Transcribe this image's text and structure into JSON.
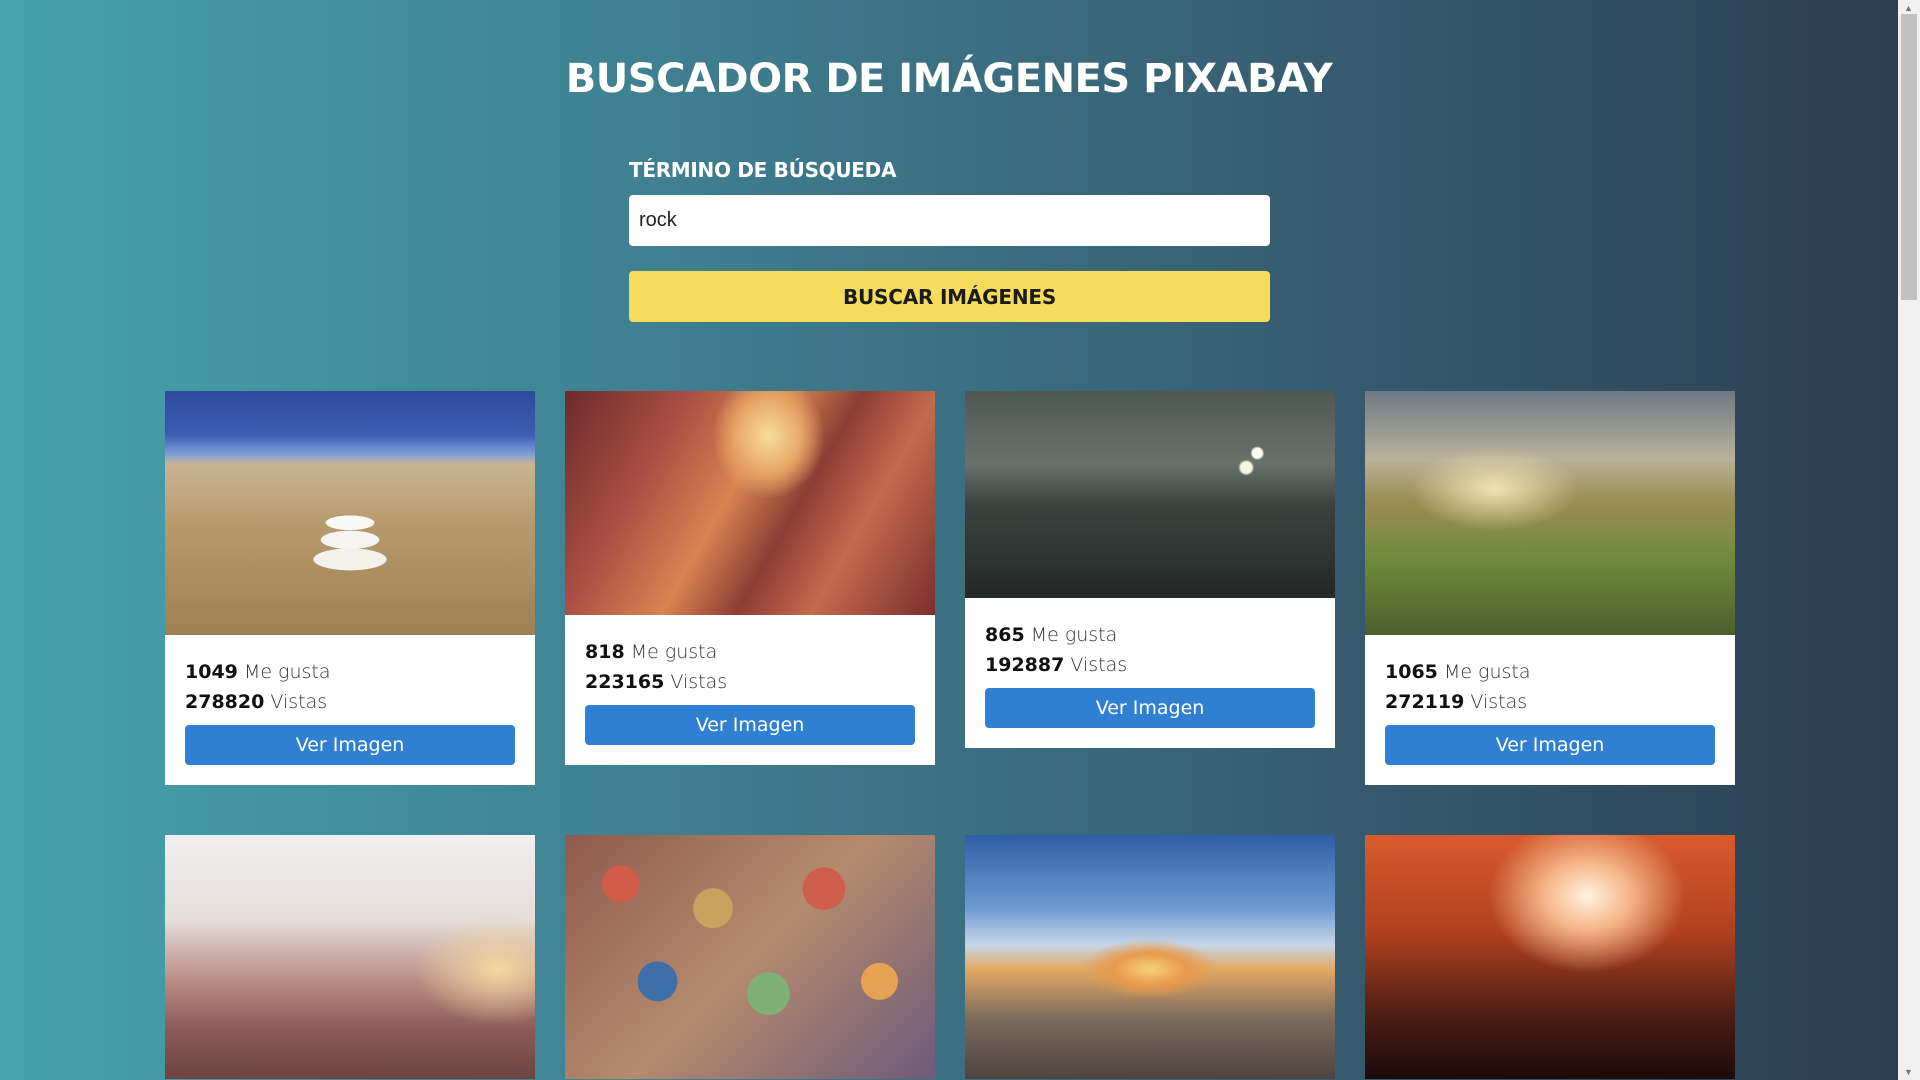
{
  "header": {
    "title": "BUSCADOR DE IMÁGENES PIXABAY"
  },
  "search": {
    "label": "TÉRMINO DE BÚSQUEDA",
    "value": "rock",
    "button_label": "BUSCAR IMÁGENES"
  },
  "cards": [
    {
      "likes": "1049",
      "likes_label": "Me gusta",
      "views": "278820",
      "views_label": "Vistas",
      "button_label": "Ver Imagen"
    },
    {
      "likes": "818",
      "likes_label": "Me gusta",
      "views": "223165",
      "views_label": "Vistas",
      "button_label": "Ver Imagen"
    },
    {
      "likes": "865",
      "likes_label": "Me gusta",
      "views": "192887",
      "views_label": "Vistas",
      "button_label": "Ver Imagen"
    },
    {
      "likes": "1065",
      "likes_label": "Me gusta",
      "views": "272119",
      "views_label": "Vistas",
      "button_label": "Ver Imagen"
    }
  ],
  "colors": {
    "search_button": "#f5dc5b",
    "view_button": "#2f80d2",
    "background_start": "#45a2ad",
    "background_end": "#2c3d50"
  }
}
